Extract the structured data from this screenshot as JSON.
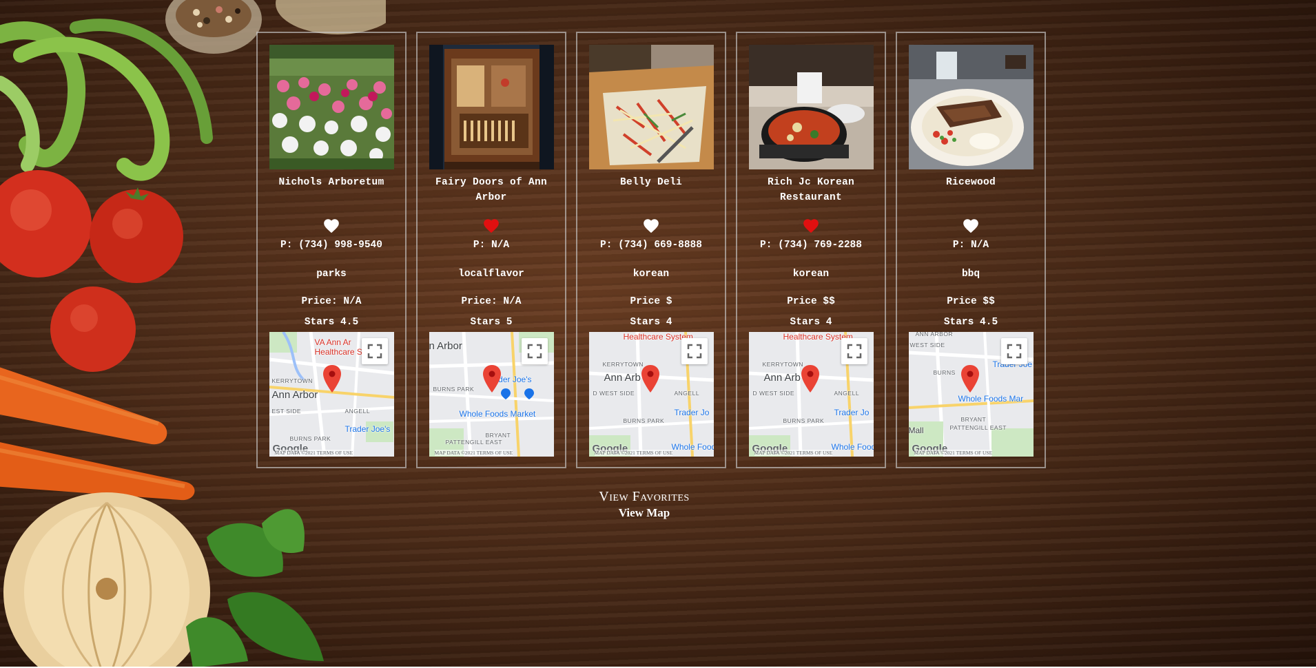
{
  "cards": [
    {
      "name": "Nichols Arboretum",
      "favorited": false,
      "phone": "P: (734) 998-9540",
      "category": "parks",
      "price": "Price: N/A",
      "stars": "Stars 4.5",
      "map": {
        "labels": [
          "VA Ann Ar",
          "Healthcare Syst",
          "KERRYTOWN",
          "Ann Arbor",
          "ANGELL",
          "EST SIDE",
          "BURNS PARK",
          "Trader Joe's"
        ],
        "footer": "MAP DATA ©2021    TERMS OF USE"
      }
    },
    {
      "name": "Fairy Doors of Ann Arbor",
      "favorited": true,
      "phone": "P: N/A",
      "category": "localflavor",
      "price": "Price: N/A",
      "stars": "Stars 5",
      "map": {
        "labels": [
          "n Arbor",
          "BURNS PARK",
          "rader Joe's",
          "Whole Foods Market",
          "BRYANT",
          "PATTENGILL EAST"
        ],
        "footer": "MAP DATA ©2021    TERMS OF USE"
      }
    },
    {
      "name": "Belly Deli",
      "favorited": false,
      "phone": "P: (734) 669-8888",
      "category": "korean",
      "price": "Price $",
      "stars": "Stars 4",
      "map": {
        "labels": [
          "Healthcare System",
          "KERRYTOWN",
          "Ann Arb",
          "ANGELL",
          "D WEST SIDE",
          "BURNS PARK",
          "Trader Jo",
          "Whole Foods M"
        ],
        "footer": "MAP DATA ©2021    TERMS OF USE"
      }
    },
    {
      "name": "Rich Jc Korean Restaurant",
      "favorited": true,
      "phone": "P: (734) 769-2288",
      "category": "korean",
      "price": "Price $$",
      "stars": "Stars 4",
      "map": {
        "labels": [
          "Healthcare System",
          "KERRYTOWN",
          "Ann Arb",
          "ANGELL",
          "D WEST SIDE",
          "BURNS PARK",
          "Trader Jo",
          "Whole Foods M"
        ],
        "footer": "MAP DATA ©2021    TERMS OF USE"
      }
    },
    {
      "name": "Ricewood",
      "favorited": false,
      "phone": "P: N/A",
      "category": "bbq",
      "price": "Price $$",
      "stars": "Stars 4.5",
      "map": {
        "labels": [
          "ANN ARBOR",
          "WEST SIDE",
          "BURNS",
          "Trader Joe",
          "Whole Foods Mar",
          "BRYANT",
          "PATTENGILL EAST",
          "Mall"
        ],
        "footer": "MAP DATA ©2021    TERMS OF USE"
      }
    }
  ],
  "map_branding": "Google",
  "links": {
    "view_favorites": "View Favorites",
    "view_map": "View Map"
  },
  "icons": {
    "heart_favorited_color": "#e01010",
    "heart_default_color": "#ffffff",
    "pin_color": "#ea4335"
  }
}
